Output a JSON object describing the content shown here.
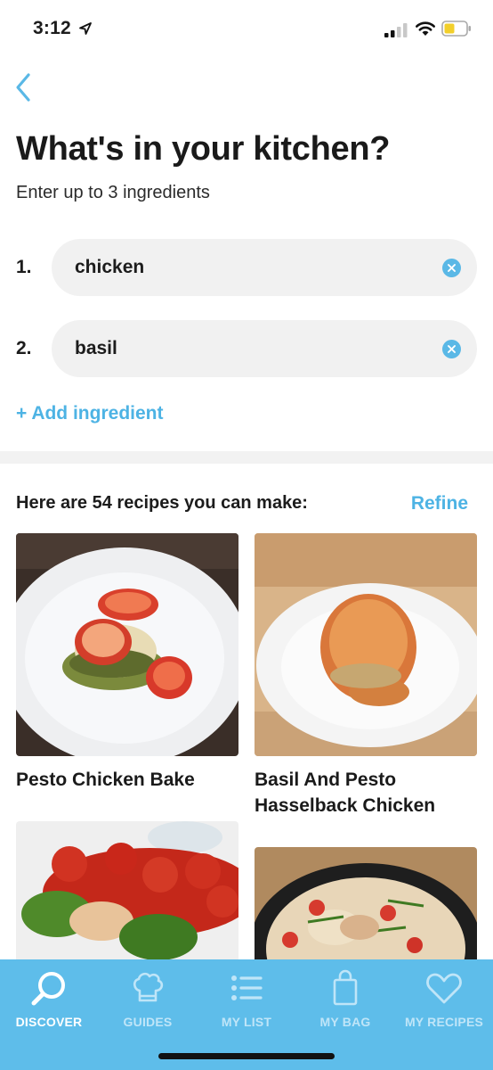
{
  "status": {
    "time": "3:12"
  },
  "page": {
    "title": "What's in your kitchen?",
    "subtitle": "Enter up to 3 ingredients"
  },
  "ingredients": [
    {
      "number": "1.",
      "value": "chicken"
    },
    {
      "number": "2.",
      "value": "basil"
    }
  ],
  "add_ingredient": "+ Add ingredient",
  "results": {
    "heading": "Here are 54 recipes you can make:",
    "refine": "Refine",
    "recipes": [
      {
        "title": "Pesto Chicken Bake"
      },
      {
        "title": "Basil And Pesto Hasselback Chicken"
      },
      {
        "title": ""
      },
      {
        "title": ""
      }
    ]
  },
  "tabs": [
    {
      "label": "DISCOVER",
      "icon": "search-icon",
      "active": true
    },
    {
      "label": "GUIDES",
      "icon": "chef-hat-icon",
      "active": false
    },
    {
      "label": "MY LIST",
      "icon": "list-icon",
      "active": false
    },
    {
      "label": "MY BAG",
      "icon": "bag-icon",
      "active": false
    },
    {
      "label": "MY RECIPES",
      "icon": "heart-icon",
      "active": false
    }
  ],
  "colors": {
    "accent": "#4db3e4",
    "tab_bar": "#5ebdea",
    "field_bg": "#f1f1f1"
  }
}
